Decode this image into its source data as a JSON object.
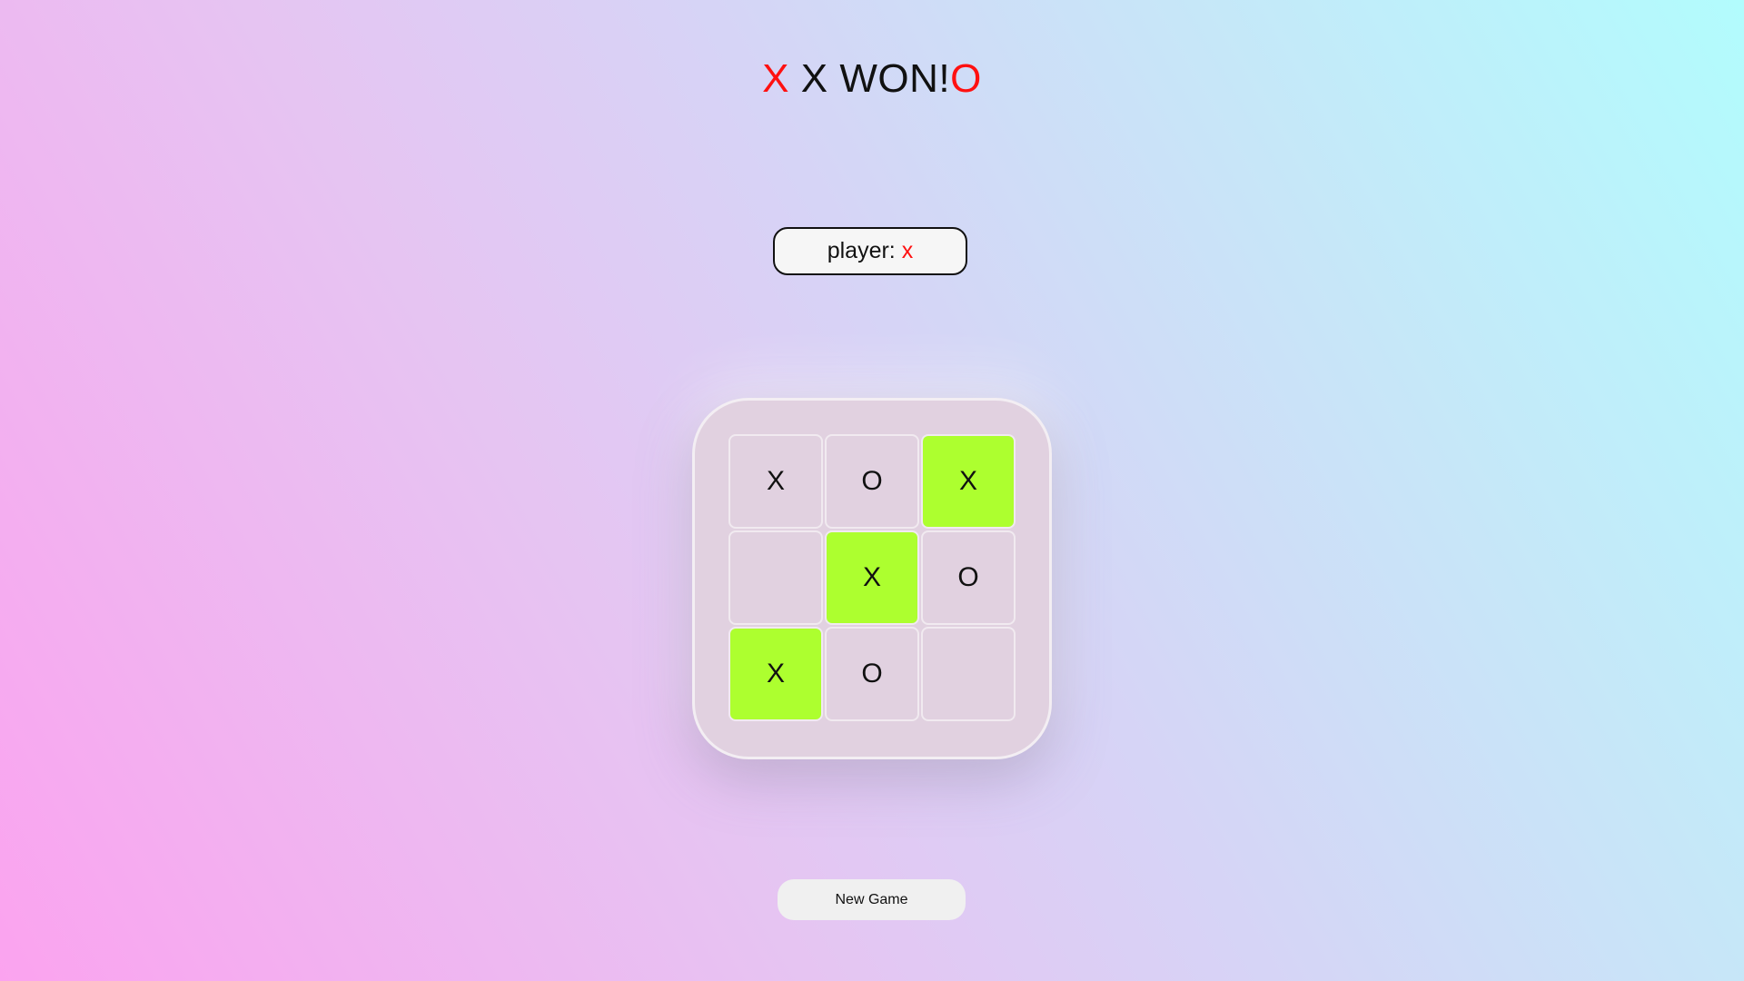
{
  "header": {
    "left_mark": "X",
    "message": "X WON!",
    "right_mark": "O"
  },
  "player": {
    "label": "player:",
    "value": "x"
  },
  "board": {
    "cells": [
      {
        "value": "X",
        "winning": false
      },
      {
        "value": "O",
        "winning": false
      },
      {
        "value": "X",
        "winning": true
      },
      {
        "value": "",
        "winning": false
      },
      {
        "value": "X",
        "winning": true
      },
      {
        "value": "O",
        "winning": false
      },
      {
        "value": "X",
        "winning": true
      },
      {
        "value": "O",
        "winning": false
      },
      {
        "value": "",
        "winning": false
      }
    ]
  },
  "actions": {
    "new_game_label": "New Game"
  },
  "colors": {
    "accent_red": "#ff1010",
    "win_highlight": "#adff2f",
    "board_bg": "#e1d1e0"
  }
}
